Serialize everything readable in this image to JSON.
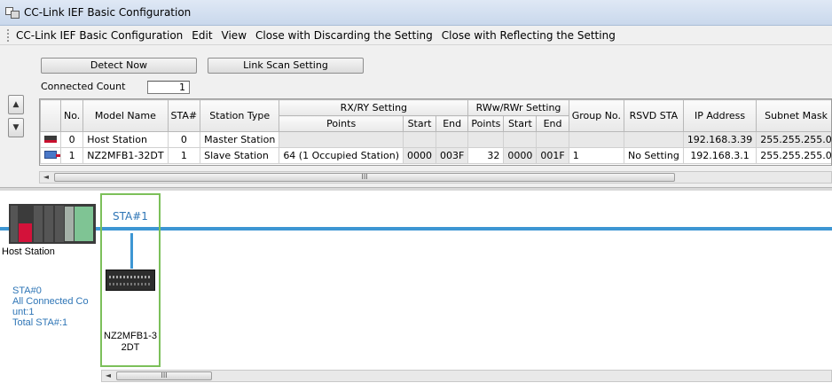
{
  "window": {
    "title": "CC-Link IEF Basic Configuration"
  },
  "menu": [
    "CC-Link IEF Basic Configuration",
    "Edit",
    "View",
    "Close with Discarding the Setting",
    "Close with Reflecting the Setting"
  ],
  "toolbar": {
    "detect_now": "Detect Now",
    "link_scan_setting": "Link Scan Setting",
    "connected_count_label": "Connected Count",
    "connected_count_value": "1"
  },
  "table": {
    "headers": {
      "no": "No.",
      "model_name": "Model Name",
      "sta": "STA#",
      "station_type": "Station Type",
      "rxry": "RX/RY Setting",
      "rwwrwr": "RWw/RWr Setting",
      "points": "Points",
      "start": "Start",
      "end": "End",
      "group_no": "Group No.",
      "rsvd_sta": "RSVD STA",
      "ip_address": "IP Address",
      "subnet_mask": "Subnet Mask"
    },
    "rows": [
      {
        "icon": "host-station-icon",
        "no": "0",
        "model": "Host Station",
        "sta": "0",
        "type": "Master Station",
        "rx_points": "",
        "rx_start": "",
        "rx_end": "",
        "rw_points": "",
        "rw_start": "",
        "rw_end": "",
        "group": "",
        "rsvd": "",
        "ip": "192.168.3.39",
        "subnet": "255.255.255.0"
      },
      {
        "icon": "slave-station-icon",
        "no": "1",
        "model": "NZ2MFB1-32DT",
        "sta": "1",
        "type": "Slave Station",
        "rx_points": "64 (1 Occupied Station)",
        "rx_start": "0000",
        "rx_end": "003F",
        "rw_points": "32",
        "rw_start": "0000",
        "rw_end": "001F",
        "group": "1",
        "rsvd": "No Setting",
        "ip": "192.168.3.1",
        "subnet": "255.255.255.0"
      }
    ]
  },
  "scroll": {
    "thumb_glyph": "III"
  },
  "network": {
    "host_label": "Host Station",
    "info_lines": [
      "STA#0",
      "All Connected Co",
      "unt:1",
      "Total STA#:1"
    ],
    "station": {
      "title": "STA#1",
      "model_line1": "NZ2MFB1-3",
      "model_line2": "2DT"
    }
  },
  "colors": {
    "bus": "#3d96d3",
    "station_border": "#7cc05a",
    "info_text": "#2e75b6"
  }
}
